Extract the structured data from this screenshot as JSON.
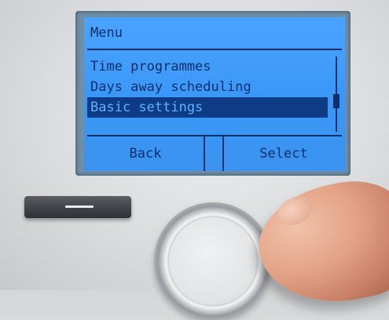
{
  "screen": {
    "title": "Menu",
    "items": [
      {
        "label": "Time programmes",
        "selected": false
      },
      {
        "label": "Days away scheduling",
        "selected": false
      },
      {
        "label": "Basic settings",
        "selected": true
      }
    ],
    "softkeys": {
      "left": "Back",
      "right": "Select"
    }
  },
  "colors": {
    "lcd_background": "#3a97f6",
    "lcd_text": "#0c2f6e",
    "highlight": "#0e3b86"
  },
  "hardware": {
    "left_button_icon": "horizontal-line-icon",
    "right_button_icon": "horizontal-line-icon",
    "dial_icon": "rotary-knob"
  }
}
